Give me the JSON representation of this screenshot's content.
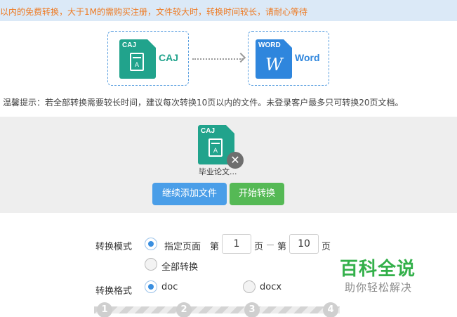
{
  "notice": {
    "text": "以内的免费转换，大于1M的需购买注册，文件较大时，转换时间较长，请耐心等待"
  },
  "conversion": {
    "source": {
      "icon_tag": "CAJ",
      "label": "CAJ",
      "color": "#21a38c"
    },
    "target": {
      "icon_tag": "WORD",
      "label": "Word",
      "glyph": "W",
      "color": "#2f86dd"
    }
  },
  "tip": {
    "text": "温馨提示：若全部转换需要较长时间，建议每次转换10页以内的文件。未登录客户最多只可转换20页文档。"
  },
  "upload": {
    "file": {
      "icon_tag": "CAJ",
      "name": "毕业论文...",
      "remove_glyph": "✕"
    },
    "add_button": "继续添加文件",
    "start_button": "开始转换"
  },
  "form": {
    "mode_label": "转换模式",
    "mode_page_option": "指定页面",
    "page_prefix": "第",
    "page_from": "1",
    "page_mid": "页",
    "page_prefix2": "第",
    "page_to": "10",
    "page_suffix": "页",
    "mode_all_option": "全部转换",
    "format_label": "转换格式",
    "format_doc": "doc",
    "format_docx": "docx"
  },
  "steps": [
    "1",
    "2",
    "3",
    "4"
  ],
  "watermark": {
    "title": "百科全说",
    "subtitle": "助你轻松解决"
  },
  "colors": {
    "accent": "#4a9ee8",
    "start": "#55b955",
    "notice_text": "#ee7a22",
    "watermark": "#33b04a"
  }
}
